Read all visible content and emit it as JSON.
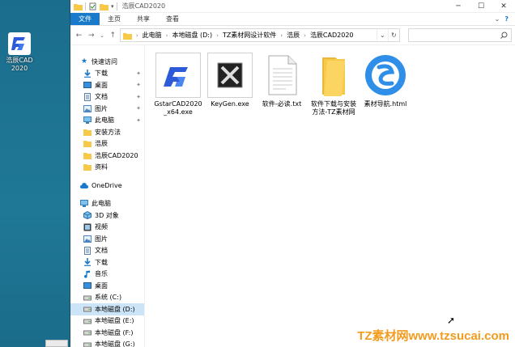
{
  "desktop": {
    "icon_label": "浩辰CAD 2020"
  },
  "window": {
    "title": "浩辰CAD2020",
    "ribbon_tabs": [
      "文件",
      "主页",
      "共享",
      "查看"
    ]
  },
  "address": {
    "crumbs": [
      "此电脑",
      "本地磁盘 (D:)",
      "TZ素材网设计软件",
      "浩辰",
      "浩辰CAD2020"
    ]
  },
  "nav": {
    "quick_access": "快速访问",
    "quick_items": [
      {
        "label": "下载",
        "icon": "download-icon",
        "pinned": true
      },
      {
        "label": "桌面",
        "icon": "desktop-icon",
        "pinned": true
      },
      {
        "label": "文档",
        "icon": "document-icon",
        "pinned": true
      },
      {
        "label": "图片",
        "icon": "pictures-icon",
        "pinned": true
      },
      {
        "label": "此电脑",
        "icon": "computer-icon",
        "pinned": true
      },
      {
        "label": "安装方法",
        "icon": "folder-icon",
        "pinned": false
      },
      {
        "label": "浩辰",
        "icon": "folder-icon",
        "pinned": false
      },
      {
        "label": "浩辰CAD2020",
        "icon": "folder-icon",
        "pinned": false
      },
      {
        "label": "资料",
        "icon": "folder-icon",
        "pinned": false
      }
    ],
    "onedrive": "OneDrive",
    "this_pc": "此电脑",
    "pc_items": [
      {
        "label": "3D 对象",
        "icon": "3d-objects-icon"
      },
      {
        "label": "视频",
        "icon": "video-icon"
      },
      {
        "label": "图片",
        "icon": "pictures-icon"
      },
      {
        "label": "文档",
        "icon": "document-icon"
      },
      {
        "label": "下载",
        "icon": "download-icon"
      },
      {
        "label": "音乐",
        "icon": "music-icon"
      },
      {
        "label": "桌面",
        "icon": "desktop-icon"
      },
      {
        "label": "系统 (C:)",
        "icon": "drive-icon"
      },
      {
        "label": "本地磁盘 (D:)",
        "icon": "drive-icon",
        "selected": true
      },
      {
        "label": "本地磁盘 (E:)",
        "icon": "drive-icon"
      },
      {
        "label": "本地磁盘 (F:)",
        "icon": "drive-icon"
      },
      {
        "label": "本地磁盘 (G:)",
        "icon": "drive-icon"
      }
    ]
  },
  "files": [
    {
      "name": "GstarCAD2020_x64.exe",
      "icon": "gstarcad-icon"
    },
    {
      "name": "KeyGen.exe",
      "icon": "keygen-icon"
    },
    {
      "name": "软件-必读.txt",
      "icon": "text-file-icon"
    },
    {
      "name": "软件下载与安装方法-TZ素材网",
      "icon": "folder-icon"
    },
    {
      "name": "素材导航.html",
      "icon": "sogou-browser-icon"
    }
  ],
  "watermark": "TZ素材网www.tzsucai.com",
  "colors": {
    "accent": "#1979ca",
    "desktop": "#1f6e8e",
    "watermark": "#f29b1d",
    "folder": "#f7c948"
  }
}
